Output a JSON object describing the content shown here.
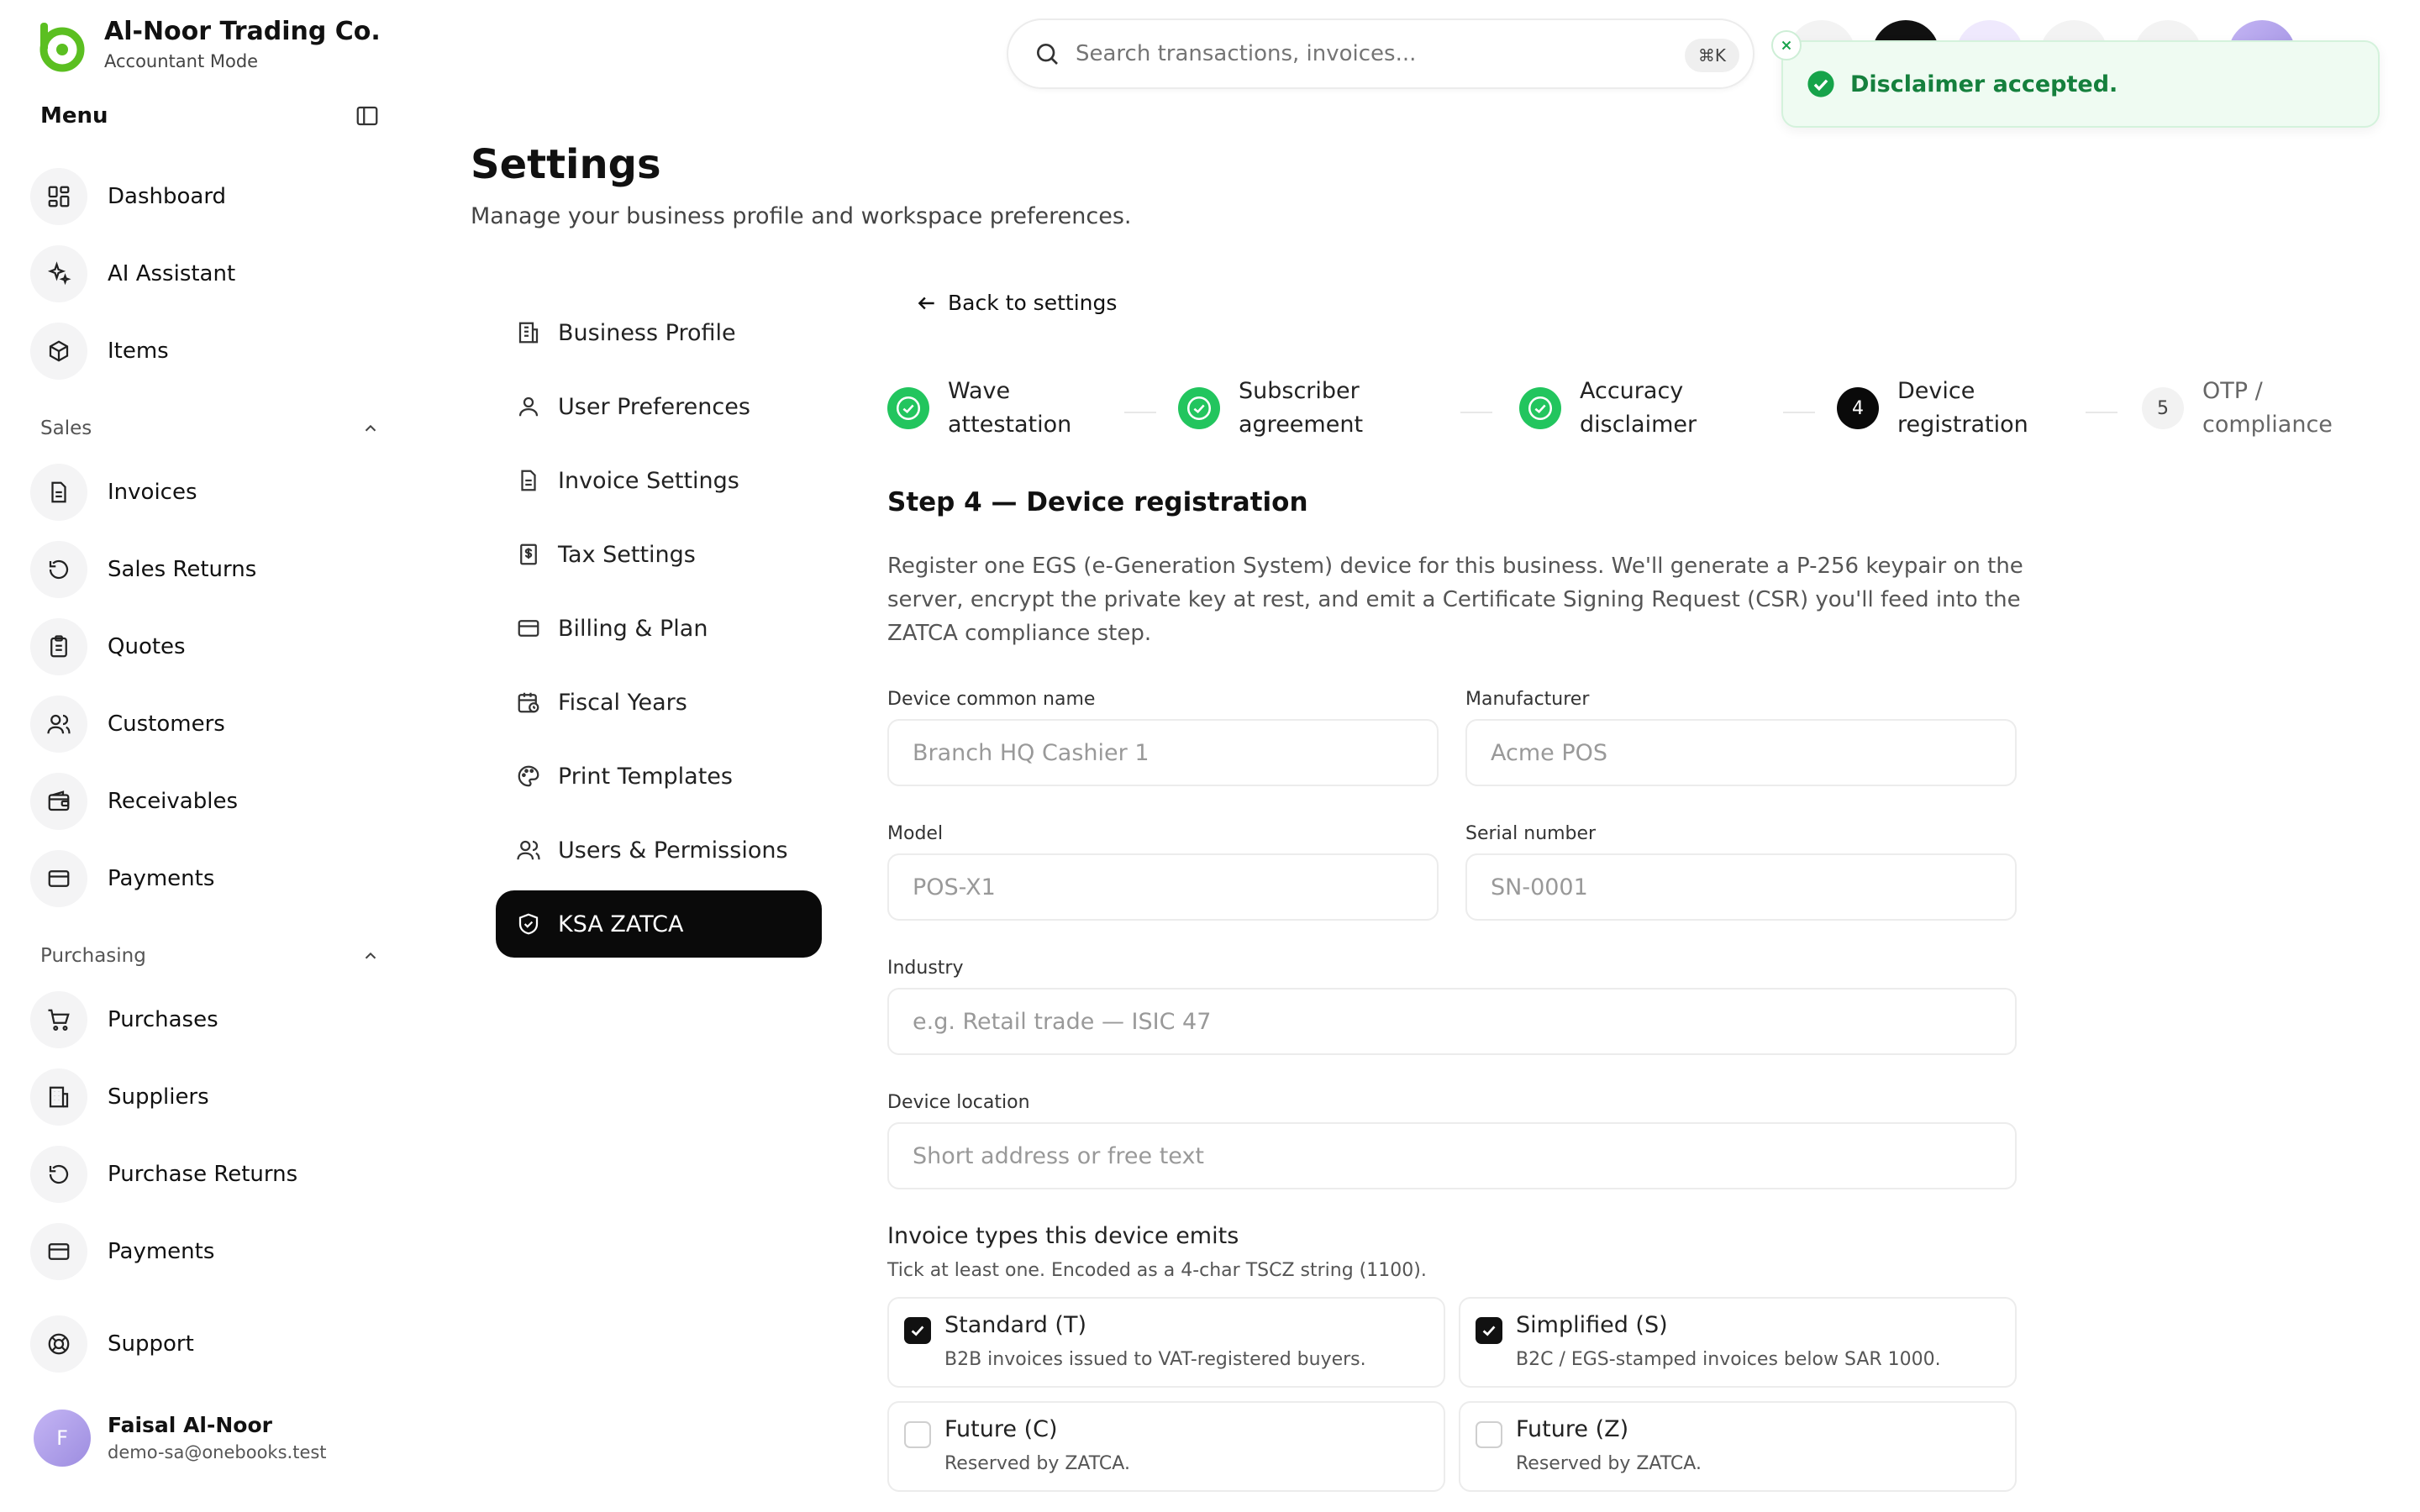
{
  "brand": {
    "name": "Al-Noor Trading Co.",
    "mode": "Accountant Mode"
  },
  "sidebar": {
    "menu_title": "Menu",
    "main_items": [
      {
        "label": "Dashboard",
        "icon": "dashboard-icon"
      },
      {
        "label": "AI Assistant",
        "icon": "sparkle-icon"
      },
      {
        "label": "Items",
        "icon": "box-icon"
      }
    ],
    "sales": {
      "title": "Sales",
      "items": [
        {
          "label": "Invoices",
          "icon": "document-icon"
        },
        {
          "label": "Sales Returns",
          "icon": "rotate-icon"
        },
        {
          "label": "Quotes",
          "icon": "clipboard-icon"
        },
        {
          "label": "Customers",
          "icon": "users-icon"
        },
        {
          "label": "Receivables",
          "icon": "wallet-icon"
        },
        {
          "label": "Payments",
          "icon": "credit-card-icon"
        }
      ]
    },
    "purchasing": {
      "title": "Purchasing",
      "items": [
        {
          "label": "Purchases",
          "icon": "cart-icon"
        },
        {
          "label": "Suppliers",
          "icon": "building-icon"
        },
        {
          "label": "Purchase Returns",
          "icon": "rotate-icon"
        },
        {
          "label": "Payments",
          "icon": "credit-card-icon"
        }
      ]
    },
    "support": {
      "label": "Support",
      "icon": "lifebuoy-icon"
    },
    "user": {
      "initial": "F",
      "name": "Faisal Al-Noor",
      "email": "demo-sa@onebooks.test"
    }
  },
  "search": {
    "placeholder": "Search transactions, invoices...",
    "shortcut": "⌘K"
  },
  "toast": {
    "message": "Disclaimer accepted.",
    "color": "#15803d"
  },
  "page": {
    "title": "Settings",
    "subtitle": "Manage your business profile and workspace preferences."
  },
  "settings_nav": [
    {
      "label": "Business Profile",
      "icon": "building-icon",
      "active": false
    },
    {
      "label": "User Preferences",
      "icon": "user-icon",
      "active": false
    },
    {
      "label": "Invoice Settings",
      "icon": "document-icon",
      "active": false
    },
    {
      "label": "Tax Settings",
      "icon": "dollar-doc-icon",
      "active": false
    },
    {
      "label": "Billing & Plan",
      "icon": "credit-card-icon",
      "active": false
    },
    {
      "label": "Fiscal Years",
      "icon": "calendar-icon",
      "active": false
    },
    {
      "label": "Print Templates",
      "icon": "palette-icon",
      "active": false
    },
    {
      "label": "Users & Permissions",
      "icon": "users-icon",
      "active": false
    },
    {
      "label": "KSA ZATCA",
      "icon": "shield-icon",
      "active": true
    }
  ],
  "wizard": {
    "back_label": "Back to settings",
    "steps": [
      {
        "number": "1",
        "label": "Wave attestation",
        "status": "done"
      },
      {
        "number": "2",
        "label": "Subscriber agreement",
        "status": "done"
      },
      {
        "number": "3",
        "label": "Accuracy disclaimer",
        "status": "done"
      },
      {
        "number": "4",
        "label": "Device registration",
        "status": "current"
      },
      {
        "number": "5",
        "label": "OTP / compliance",
        "status": "pending"
      }
    ],
    "heading": "Step 4 — Device registration",
    "description": "Register one EGS (e-Generation System) device for this business. We'll generate a P-256 keypair on the server, encrypt the private key at rest, and emit a Certificate Signing Request (CSR) you'll feed into the ZATCA compliance step.",
    "fields": {
      "common_name": {
        "label": "Device common name",
        "placeholder": "Branch HQ Cashier 1",
        "value": ""
      },
      "manufacturer": {
        "label": "Manufacturer",
        "placeholder": "Acme POS",
        "value": ""
      },
      "model": {
        "label": "Model",
        "placeholder": "POS-X1",
        "value": ""
      },
      "serial": {
        "label": "Serial number",
        "placeholder": "SN-0001",
        "value": ""
      },
      "industry": {
        "label": "Industry",
        "placeholder": "e.g. Retail trade — ISIC 47",
        "value": ""
      },
      "location": {
        "label": "Device location",
        "placeholder": "Short address or free text",
        "value": ""
      }
    },
    "invoice_types": {
      "title": "Invoice types this device emits",
      "hint": "Tick at least one. Encoded as a 4-char TSCZ string (1100).",
      "options": [
        {
          "title": "Standard (T)",
          "desc": "B2B invoices issued to VAT-registered buyers.",
          "checked": true
        },
        {
          "title": "Simplified (S)",
          "desc": "B2C / EGS-stamped invoices below SAR 1000.",
          "checked": true
        },
        {
          "title": "Future (C)",
          "desc": "Reserved by ZATCA.",
          "checked": false
        },
        {
          "title": "Future (Z)",
          "desc": "Reserved by ZATCA.",
          "checked": false
        }
      ]
    }
  },
  "colors": {
    "accent": "#0a0a0a",
    "success": "#22c55e",
    "brand_green": "#5bbf21"
  }
}
